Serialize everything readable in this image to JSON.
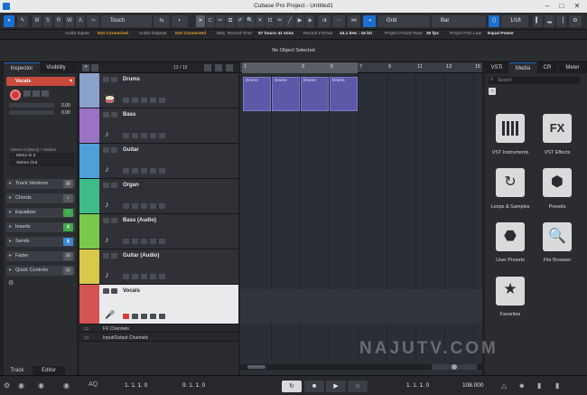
{
  "window": {
    "title": "Cubase Pro Project - Untitled1"
  },
  "toolbar": {
    "letters": [
      "M",
      "S",
      "R",
      "W",
      "A"
    ],
    "mode": "Touch",
    "snap_type": "Grid",
    "grid_unit": "Bar",
    "quantize": "1/16"
  },
  "status": {
    "audio_inputs_label": "Audio Inputs",
    "audio_inputs_value": "Not Connected",
    "audio_outputs_label": "Audio Outputs",
    "audio_outputs_value": "Not Connected",
    "rec_time_label": "Max. Record Time",
    "rec_time_value": "57 hours 41 mins",
    "rec_format_label": "Record Format",
    "rec_format_value": "44.1 kHz : 16 bit",
    "frame_rate_label": "Project Frame Rate",
    "frame_rate_value": "30 fps",
    "pan_law_label": "Project Pan Law",
    "pan_law_value": "Equal Power"
  },
  "infoline": {
    "message": "No Object Selected"
  },
  "inspector": {
    "tabs": [
      "Inspector",
      "Visibility"
    ],
    "track_name": "Vocals",
    "volume": "0.00",
    "pan": "0.00",
    "routing_label": "Stereo In (Mono) + Monitor",
    "input": "Mono In 2",
    "output": "Stereo Out",
    "sections": [
      "Track Versions",
      "Chords",
      "Equalizer",
      "Inserts",
      "Sends",
      "Fader",
      "Quick Controls"
    ],
    "bottom_tabs": [
      "Track",
      "Editor"
    ]
  },
  "tracklist": {
    "count": "13 / 13",
    "tracks": [
      {
        "name": "Drums",
        "color": "#8aa1c9"
      },
      {
        "name": "Bass",
        "color": "#9b73c5"
      },
      {
        "name": "Guitar",
        "color": "#4ea0d8"
      },
      {
        "name": "Organ",
        "color": "#3fbb8a"
      },
      {
        "name": "Bass (Audio)",
        "color": "#7ac84a"
      },
      {
        "name": "Guitar (Audio)",
        "color": "#d9c84a"
      },
      {
        "name": "Vocals",
        "color": "#d45353"
      }
    ],
    "folders": [
      "FX Channels",
      "Input/Output Channels"
    ]
  },
  "project": {
    "bars": [
      "1",
      "3",
      "5",
      "7",
      "9",
      "11",
      "13",
      "15"
    ],
    "events": [
      "Drums",
      "Drums",
      "Drums",
      "Drums"
    ]
  },
  "mediabay": {
    "tabs": [
      "VSTi",
      "Media",
      "CR",
      "Meter"
    ],
    "search_placeholder": "Search",
    "tiles": [
      "VST Instruments",
      "VST Effects",
      "Loops & Samples",
      "Presets",
      "User Presets",
      "File Browser",
      "Favorites"
    ]
  },
  "transport": {
    "left_locator": "1. 1. 1. 0",
    "right_locator": "9. 1. 1. 0",
    "position": "1. 1. 1. 0",
    "tempo": "108.000"
  },
  "watermark": "NAJUTV.COM"
}
